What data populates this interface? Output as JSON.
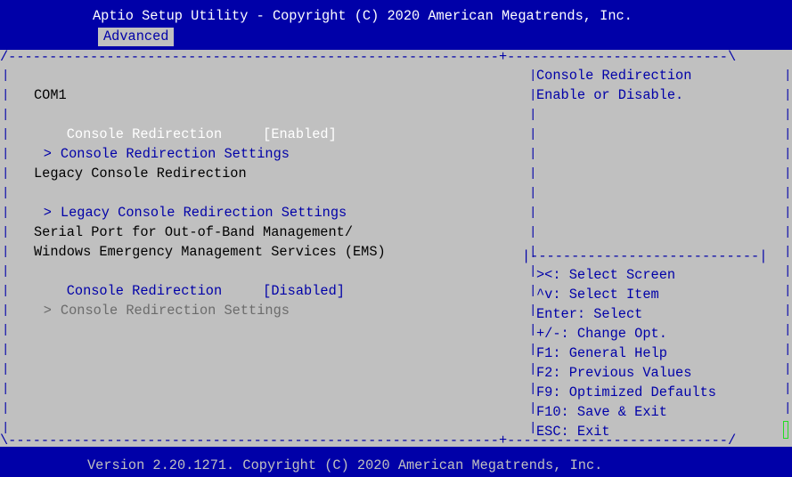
{
  "header": {
    "title": "Aptio Setup Utility - Copyright (C) 2020 American Megatrends, Inc.",
    "tab": "Advanced"
  },
  "footer": {
    "version": "Version 2.20.1271. Copyright (C) 2020 American Megatrends, Inc."
  },
  "main": {
    "com1_heading": "COM1",
    "console_redirection_label": "Console Redirection",
    "console_redirection_value": "[Enabled]",
    "console_redirection_settings": "Console Redirection Settings",
    "legacy_heading": "Legacy Console Redirection",
    "legacy_settings": "Legacy Console Redirection Settings",
    "serial_port_line1": "Serial Port for Out-of-Band Management/",
    "serial_port_line2": "Windows Emergency Management Services (EMS)",
    "ems_console_redirection_label": "Console Redirection",
    "ems_console_redirection_value": "[Disabled]",
    "ems_console_redirection_settings": "Console Redirection Settings",
    "submenu_marker": ">"
  },
  "help": {
    "line1": "Console Redirection",
    "line2": "Enable or Disable."
  },
  "keys": [
    "><: Select Screen",
    "^v: Select Item",
    "Enter: Select",
    "+/-: Change Opt.",
    "F1: General Help",
    "F2: Previous Values",
    "F9: Optimized Defaults",
    "F10: Save & Exit",
    "ESC: Exit"
  ],
  "colors": {
    "bar_blue": "#0000a8",
    "background_gray": "#c0c0c0",
    "highlight_white": "#ffffff",
    "disabled_gray": "#6b6b6b"
  }
}
